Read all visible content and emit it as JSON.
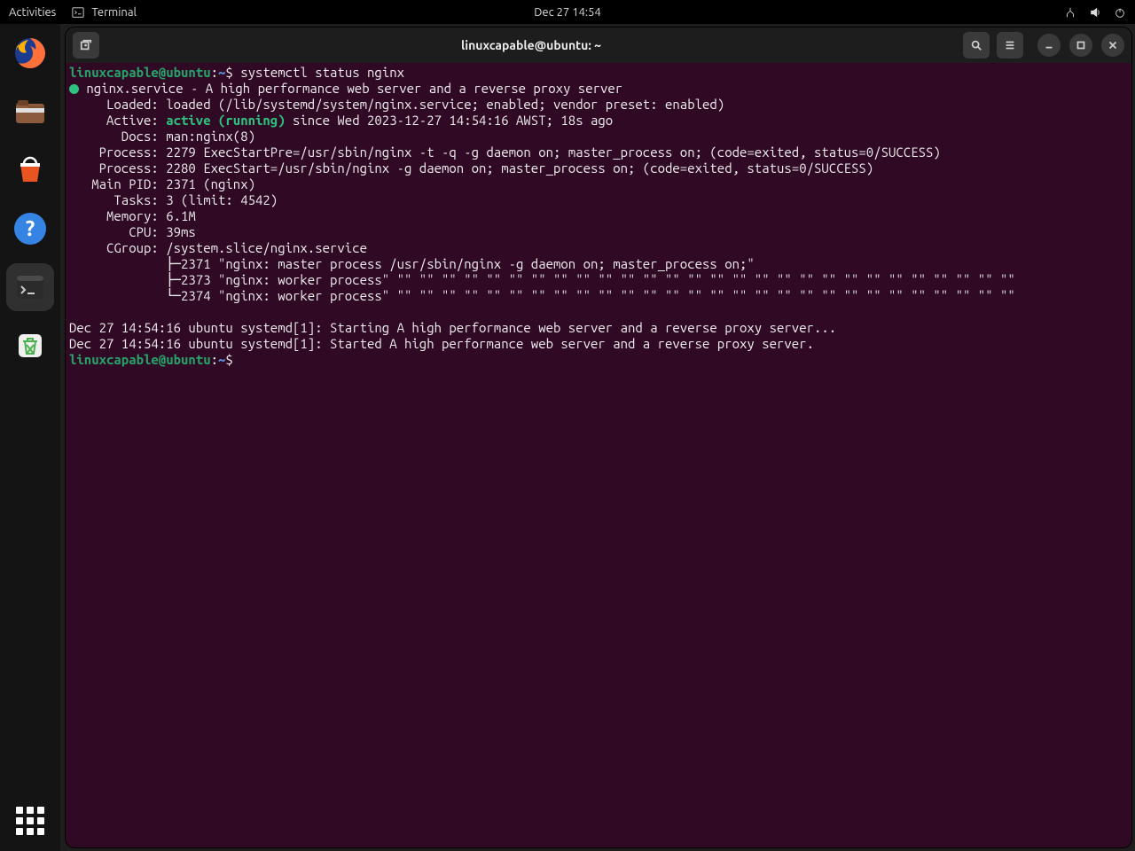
{
  "topbar": {
    "activities": "Activities",
    "app_name": "Terminal",
    "clock": "Dec 27  14:54"
  },
  "dock": {
    "items": [
      "firefox",
      "files",
      "software",
      "help",
      "terminal",
      "trash"
    ],
    "active": "terminal"
  },
  "window": {
    "title": "linuxcapable@ubuntu: ~"
  },
  "prompt1": {
    "userhost": "linuxcapable@ubuntu",
    "sep": ":",
    "path": "~",
    "dollar": "$ ",
    "command": "systemctl status nginx"
  },
  "status": {
    "dot": "●",
    "service_line": " nginx.service - A high performance web server and a reverse proxy server",
    "loaded": "     Loaded: loaded (/lib/systemd/system/nginx.service; enabled; vendor preset: enabled)",
    "active_lbl": "     Active: ",
    "active_val": "active (running)",
    "active_rest": " since Wed 2023-12-27 14:54:16 AWST; 18s ago",
    "docs": "       Docs: man:nginx(8)",
    "proc1": "    Process: 2279 ExecStartPre=/usr/sbin/nginx -t -q -g daemon on; master_process on; (code=exited, status=0/SUCCESS)",
    "proc2": "    Process: 2280 ExecStart=/usr/sbin/nginx -g daemon on; master_process on; (code=exited, status=0/SUCCESS)",
    "mainpid": "   Main PID: 2371 (nginx)",
    "tasks": "      Tasks: 3 (limit: 4542)",
    "memory": "     Memory: 6.1M",
    "cpu": "        CPU: 39ms",
    "cgroup": "     CGroup: /system.slice/nginx.service",
    "tree1": "             ├─2371 \"nginx: master process /usr/sbin/nginx -g daemon on; master_process on;\"",
    "tree2": "             ├─2373 \"nginx: worker process\" \"\" \"\" \"\" \"\" \"\" \"\" \"\" \"\" \"\" \"\" \"\" \"\" \"\" \"\" \"\" \"\" \"\" \"\" \"\" \"\" \"\" \"\" \"\" \"\" \"\" \"\" \"\" \"\"",
    "tree3": "             └─2374 \"nginx: worker process\" \"\" \"\" \"\" \"\" \"\" \"\" \"\" \"\" \"\" \"\" \"\" \"\" \"\" \"\" \"\" \"\" \"\" \"\" \"\" \"\" \"\" \"\" \"\" \"\" \"\" \"\" \"\" \"\""
  },
  "log1": "Dec 27 14:54:16 ubuntu systemd[1]: Starting A high performance web server and a reverse proxy server...",
  "log2": "Dec 27 14:54:16 ubuntu systemd[1]: Started A high performance web server and a reverse proxy server.",
  "prompt2": {
    "userhost": "linuxcapable@ubuntu",
    "sep": ":",
    "path": "~",
    "dollar": "$ "
  }
}
